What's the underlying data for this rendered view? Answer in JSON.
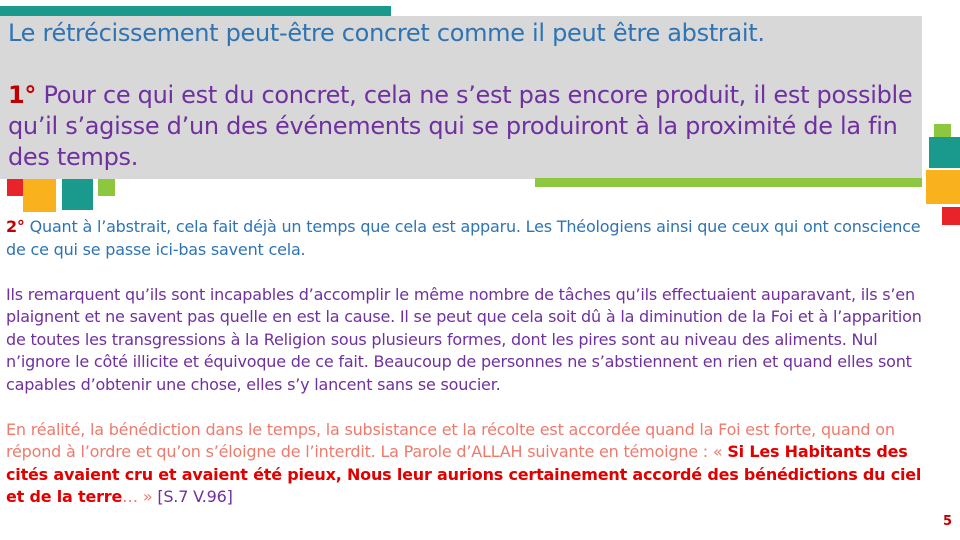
{
  "slide": {
    "subtitle": "Le rétrécissement peut-être concret comme il peut être abstrait.",
    "point1_number": "1°",
    "point1_text": " Pour ce qui est du concret, cela ne s’est pas encore produit, il est possible qu’il s’agisse d’un des événements qui se produiront à la proximité de la fin des temps.",
    "point2_number": "2°",
    "point2_text": " Quant à l’abstrait, cela fait déjà un temps que cela est apparu. Les Théologiens ainsi que ceux qui ont conscience de ce qui se passe ici-bas savent cela.",
    "paragraph3": "Ils remarquent qu’ils sont incapables d’accomplir le même nombre de tâches qu’ils effectuaient auparavant, ils s’en plaignent et ne savent pas quelle en est la cause. Il se peut que cela soit dû à la diminution de la Foi et à l’apparition de toutes les transgressions à la Religion sous plusieurs formes, dont les pires sont au niveau des aliments. Nul n’ignore le côté illicite et équivoque de ce fait. Beaucoup de personnes ne s’abstiennent en rien et quand elles sont capables d’obtenir une chose, elles s’y lancent sans se soucier.",
    "paragraph4_intro": "En réalité, la bénédiction dans le temps, la subsistance et la récolte est accordée quand la Foi est forte, quand on répond à l’ordre et qu’on s’éloigne de l’interdit. La Parole d’ALLAH suivante en témoigne : « ",
    "quote_text": "Si Les Habitants des cités avaient cru et avaient été pieux, Nous leur aurions certainement accordé des bénédictions du ciel et de la terre",
    "quote_close": "… » ",
    "reference": "[S.7 V.96]",
    "page_number": "5"
  },
  "colors": {
    "teal": "#199a8c",
    "green": "#8dc63f",
    "orange": "#f9b21d",
    "red": "#e8232a",
    "header_bg": "#d8d8d8"
  }
}
